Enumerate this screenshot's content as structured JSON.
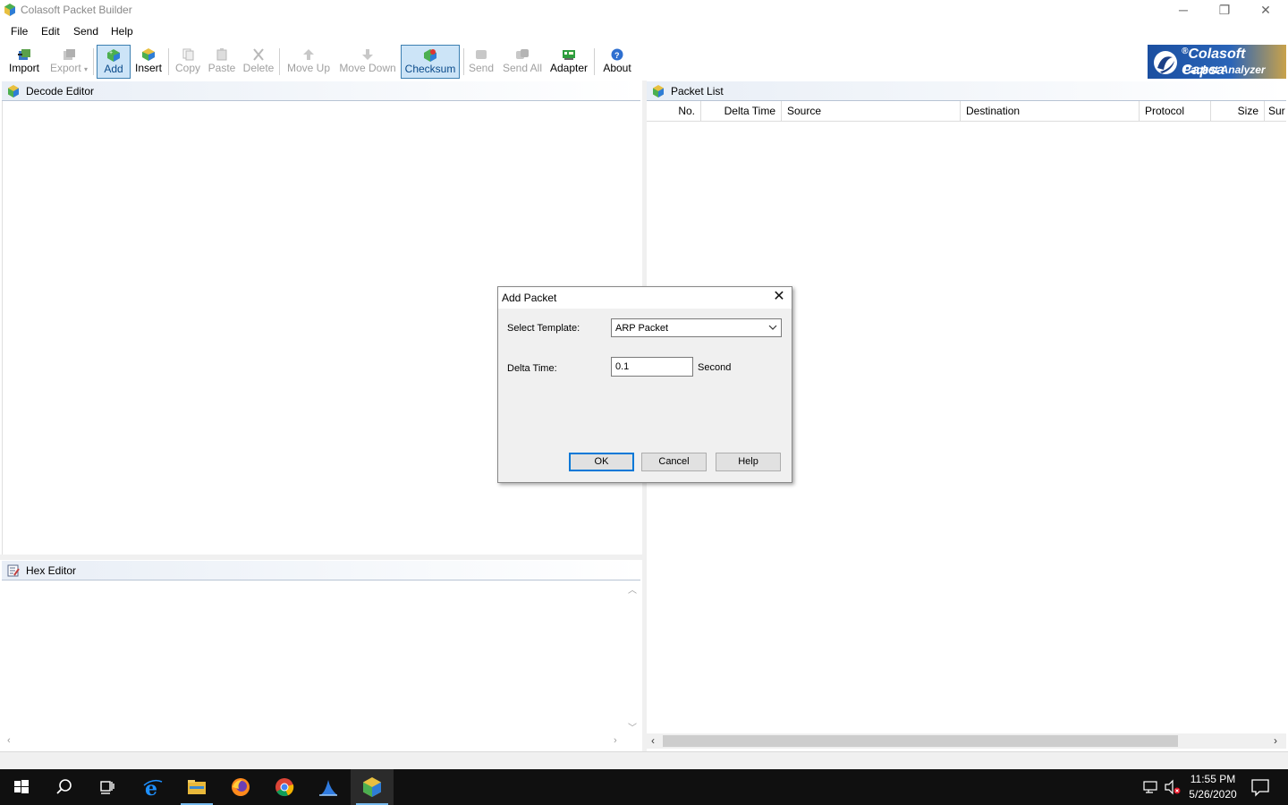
{
  "window": {
    "title": "Colasoft Packet Builder",
    "controls": {
      "minimize": "─",
      "maximize": "❐",
      "close": "✕"
    }
  },
  "menu": [
    "File",
    "Edit",
    "Send",
    "Help"
  ],
  "toolbar": {
    "import": "Import",
    "export": "Export",
    "add": "Add",
    "insert": "Insert",
    "copy": "Copy",
    "paste": "Paste",
    "delete": "Delete",
    "move_up": "Move Up",
    "move_down": "Move Down",
    "checksum": "Checksum",
    "send": "Send",
    "send_all": "Send All",
    "adapter": "Adapter",
    "about": "About"
  },
  "logo": {
    "line1": "Colasoft Capsa",
    "line2": "Packet Analyzer",
    "mark": "®"
  },
  "decode_editor": {
    "title": "Decode Editor"
  },
  "hex_editor": {
    "title": "Hex Editor"
  },
  "packet_list": {
    "title": "Packet List",
    "columns": [
      "No.",
      "Delta Time",
      "Source",
      "Destination",
      "Protocol",
      "Size",
      "Sur"
    ]
  },
  "dialog": {
    "title": "Add Packet",
    "close": "✕",
    "template_label": "Select Template:",
    "template_value": "ARP Packet",
    "delta_label": "Delta Time:",
    "delta_value": "0.1",
    "delta_unit": "Second",
    "ok": "OK",
    "cancel": "Cancel",
    "help": "Help"
  },
  "taskbar": {
    "time": "11:55 PM",
    "date": "5/26/2020",
    "icons": [
      "start-icon",
      "search-icon",
      "task-view-icon",
      "internet-explorer-icon",
      "file-explorer-icon",
      "firefox-icon",
      "chrome-icon",
      "wireshark-icon",
      "packet-builder-icon"
    ]
  },
  "colors": {
    "accent": "#0078d7",
    "taskbar": "#101010",
    "panel_header": "#e8eef6"
  }
}
